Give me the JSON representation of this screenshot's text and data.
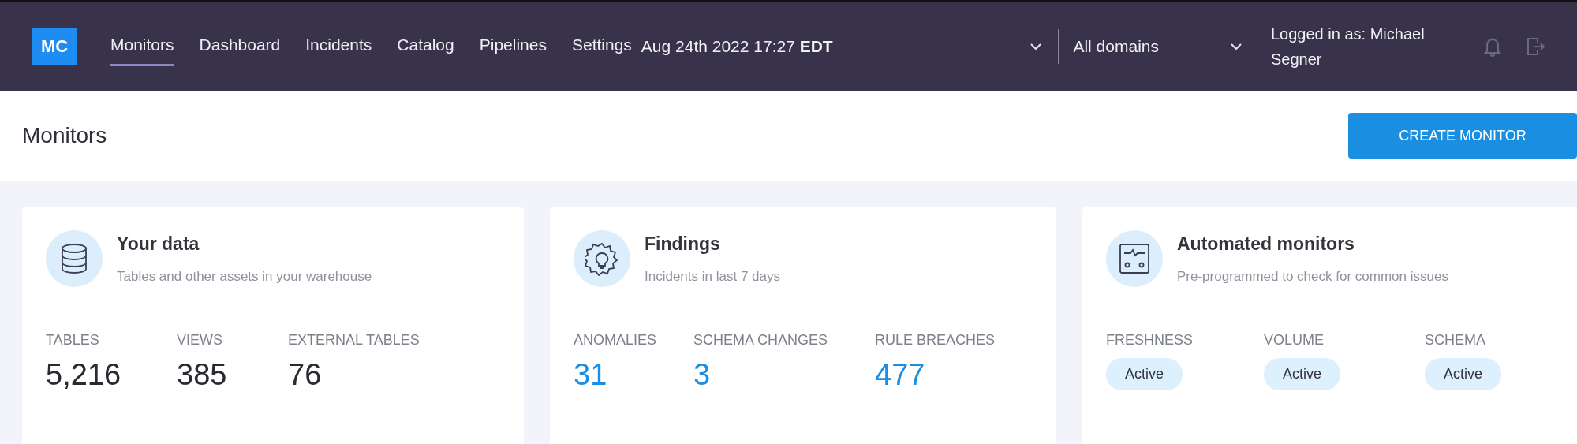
{
  "navbar": {
    "logo": "MC",
    "items": [
      {
        "label": "Monitors",
        "selected": true
      },
      {
        "label": "Dashboard",
        "selected": false
      },
      {
        "label": "Incidents",
        "selected": false
      },
      {
        "label": "Catalog",
        "selected": false
      },
      {
        "label": "Pipelines",
        "selected": false
      },
      {
        "label": "Settings",
        "selected": false
      }
    ],
    "date": "Aug 24th 2022 17:27 **EDT**",
    "domain": "All domains",
    "user": "Logged in as: Michael Segner"
  },
  "page_header": {
    "title": "Monitors",
    "button": "CREATE MONITOR"
  },
  "cards": [
    {
      "title": "Your data",
      "subtitle": "Tables and other assets in your warehouse",
      "stats": [
        {
          "label": "TABLES",
          "value": "5,216",
          "kind": "count"
        },
        {
          "label": "VIEWS",
          "value": "385",
          "kind": "count"
        },
        {
          "label": "EXTERNAL TABLES",
          "value": "76",
          "kind": "count"
        }
      ]
    },
    {
      "title": "Findings",
      "subtitle": "Incidents in last 7 days",
      "stats": [
        {
          "label": "ANOMALIES",
          "value": "31",
          "kind": "link"
        },
        {
          "label": "SCHEMA CHANGES",
          "value": "3",
          "kind": "link"
        },
        {
          "label": "RULE BREACHES",
          "value": "477",
          "kind": "link"
        }
      ]
    },
    {
      "title": "Automated monitors",
      "subtitle": "Pre-programmed to check for common issues",
      "stats": [
        {
          "label": "FRESHNESS",
          "value": "Active",
          "kind": "status"
        },
        {
          "label": "VOLUME",
          "value": "Active",
          "kind": "status"
        },
        {
          "label": "SCHEMA",
          "value": "Active",
          "kind": "status"
        }
      ]
    }
  ]
}
